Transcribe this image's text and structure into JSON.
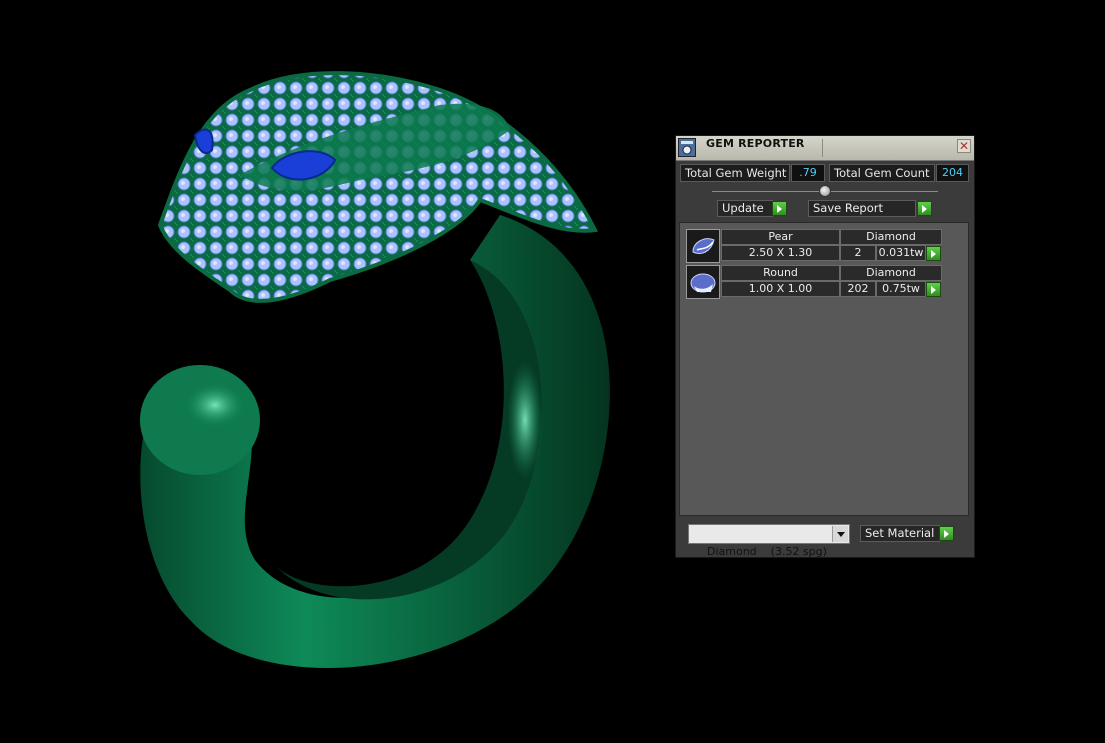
{
  "app": {
    "panel_title": "GEM REPORTER"
  },
  "totals": {
    "weight_label": "Total Gem Weight",
    "weight_value": ".79",
    "count_label": "Total Gem Count",
    "count_value": "204"
  },
  "buttons": {
    "update": "Update",
    "save_report": "Save Report",
    "set_material": "Set Material"
  },
  "gems": [
    {
      "shape": "Pear",
      "size": "2.50 X 1.30",
      "material": "Diamond",
      "count": "2",
      "weight": "0.031tw"
    },
    {
      "shape": "Round",
      "size": "1.00 X 1.00",
      "material": "Diamond",
      "count": "202",
      "weight": "0.75tw"
    }
  ],
  "material_select": {
    "value": "Diamond    (3.52 spg)"
  },
  "colors": {
    "metal": "#0c7a4e",
    "gem": "#a8c4ff",
    "eye": "#1a3fd8",
    "accent": "#4fd0f0",
    "go_button": "#3fae2a"
  }
}
